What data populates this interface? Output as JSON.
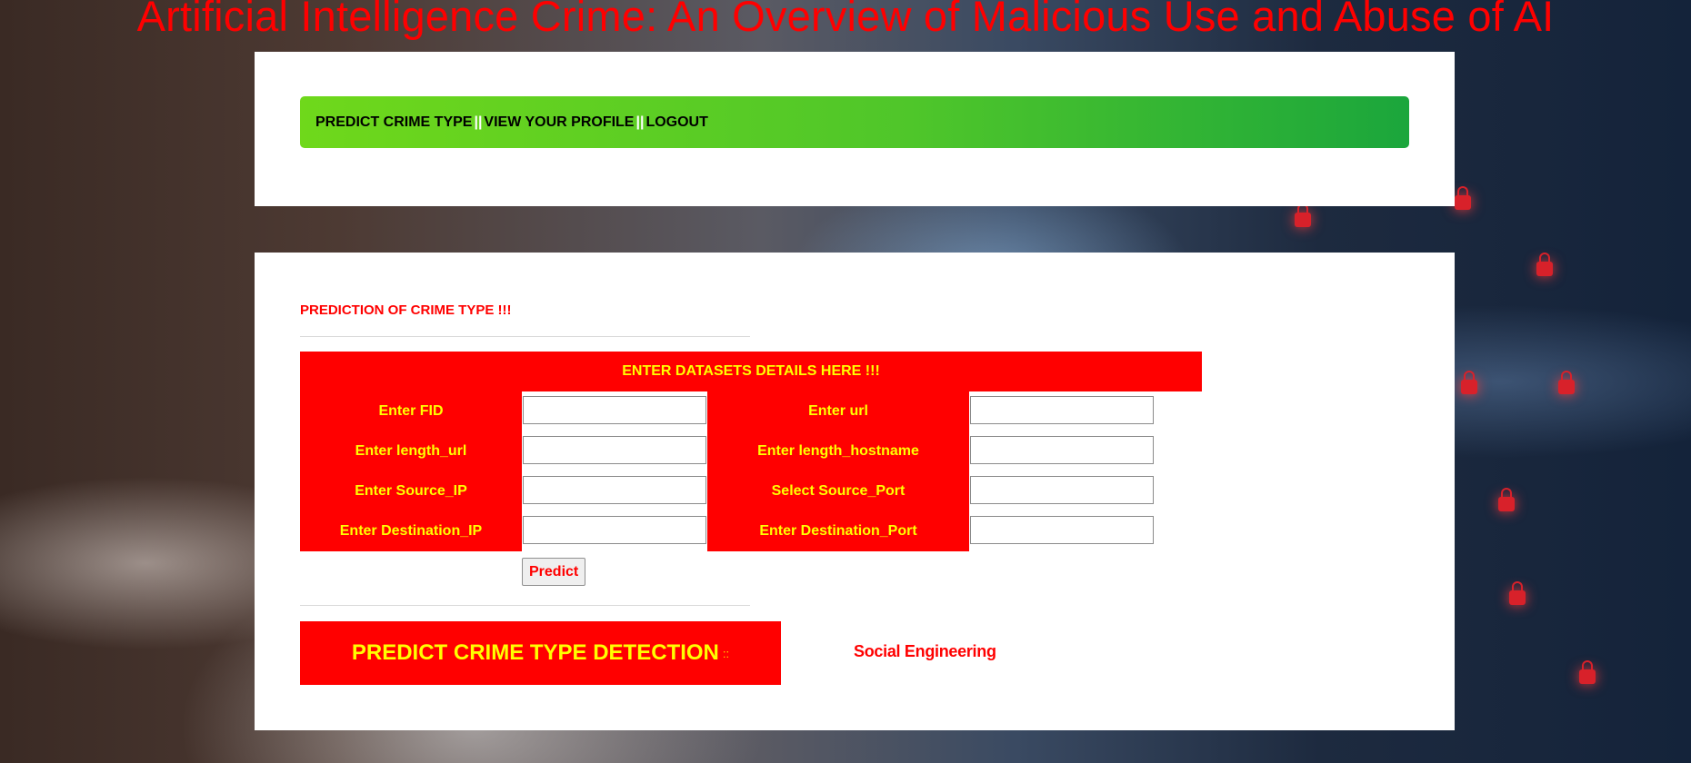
{
  "page": {
    "title": "Artificial Intelligence Crime: An Overview of Malicious Use and Abuse of AI"
  },
  "nav": {
    "items": [
      {
        "label": "PREDICT CRIME TYPE"
      },
      {
        "label": "VIEW YOUR PROFILE"
      },
      {
        "label": "LOGOUT"
      }
    ],
    "separator": "||"
  },
  "form": {
    "section_title": "PREDICTION OF CRIME TYPE !!!",
    "header": "ENTER DATASETS DETAILS HERE !!!",
    "fields": [
      {
        "label": "Enter FID",
        "value": ""
      },
      {
        "label": "Enter url",
        "value": ""
      },
      {
        "label": "Enter length_url",
        "value": ""
      },
      {
        "label": "Enter length_hostname",
        "value": ""
      },
      {
        "label": "Enter Source_IP",
        "value": ""
      },
      {
        "label": "Select Source_Port",
        "value": ""
      },
      {
        "label": "Enter Destination_IP",
        "value": ""
      },
      {
        "label": "Enter Destination_Port",
        "value": ""
      }
    ],
    "submit_label": "Predict"
  },
  "result": {
    "label": "PREDICT CRIME TYPE DETECTION",
    "colon": "::",
    "value": "Social Engineering"
  },
  "colors": {
    "accent_red": "#ff0000",
    "label_yellow": "#ffff00",
    "nav_green_start": "#6fd81b",
    "nav_green_end": "#1ba63c"
  }
}
